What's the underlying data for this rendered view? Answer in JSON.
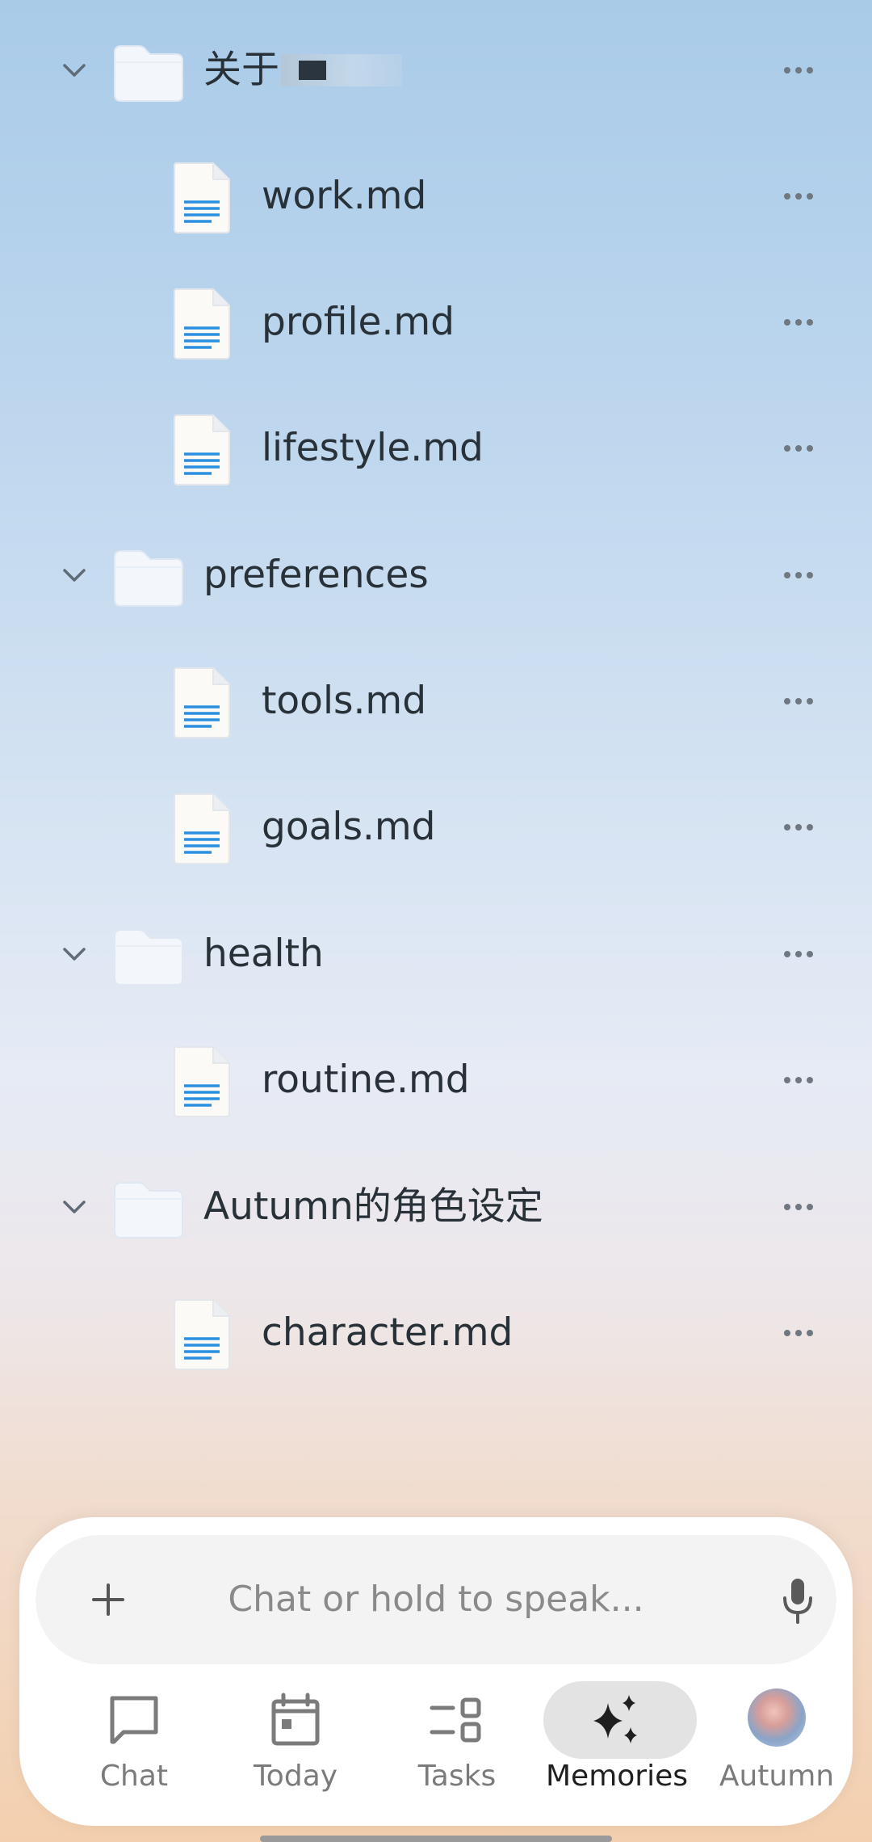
{
  "tree": {
    "folders": [
      {
        "name": "关于",
        "files": [
          "work.md",
          "profile.md",
          "lifestyle.md"
        ]
      },
      {
        "name": "preferences",
        "files": [
          "tools.md",
          "goals.md"
        ]
      },
      {
        "name": "health",
        "files": [
          "routine.md"
        ]
      },
      {
        "name": "Autumn的角色设定",
        "files": [
          "character.md"
        ]
      }
    ]
  },
  "input": {
    "placeholder": "Chat or hold to speak..."
  },
  "nav": {
    "items": [
      {
        "label": "Chat",
        "icon": "chat-bubble-icon"
      },
      {
        "label": "Today",
        "icon": "calendar-icon"
      },
      {
        "label": "Tasks",
        "icon": "tasks-icon"
      },
      {
        "label": "Memories",
        "icon": "sparkle-icon",
        "active": true
      },
      {
        "label": "Autumn",
        "icon": "avatar"
      }
    ]
  },
  "colors": {
    "active_pill": "#e3e3e3",
    "doc_lines": "#2b8fe0",
    "text": "#283038"
  }
}
